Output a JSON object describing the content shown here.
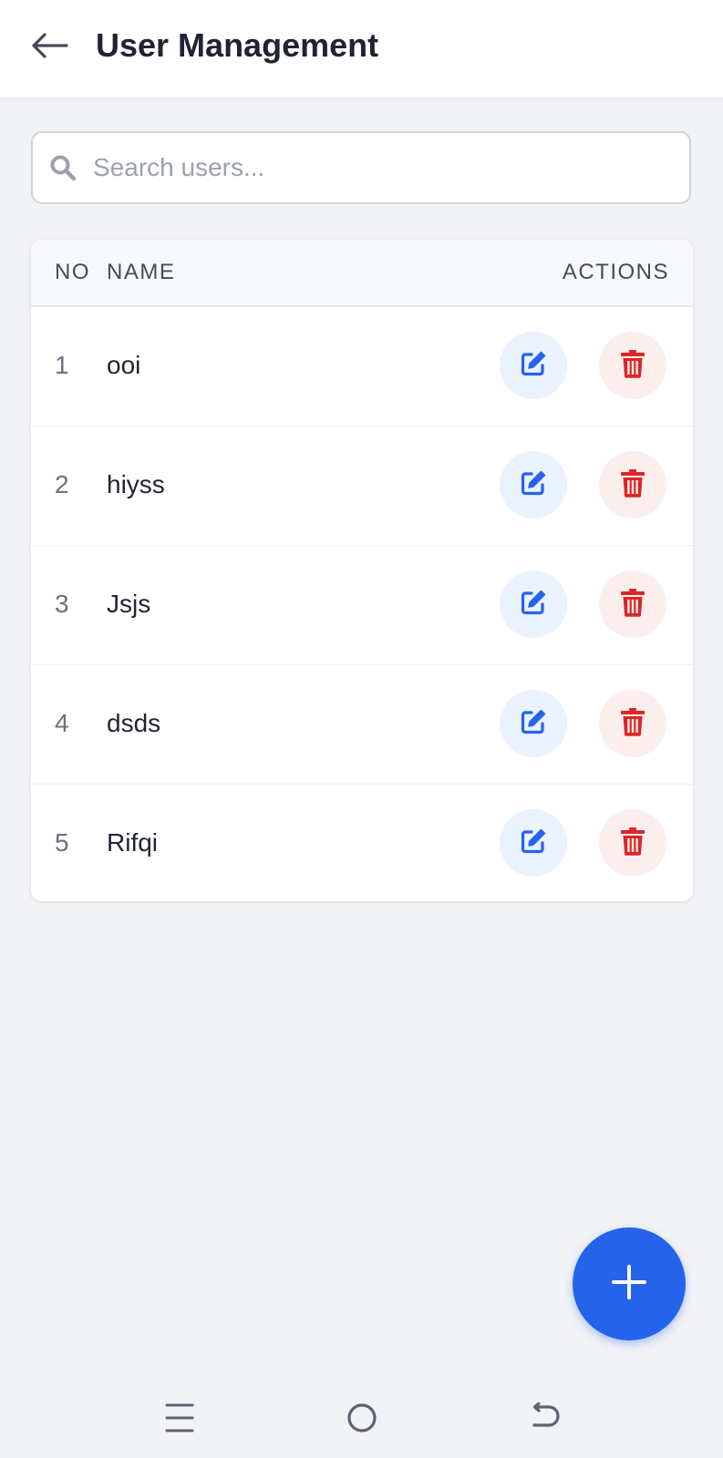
{
  "header": {
    "title": "User Management",
    "back_icon": "arrow-left-icon"
  },
  "search": {
    "placeholder": "Search users...",
    "value": "",
    "icon": "search-icon"
  },
  "table": {
    "columns": {
      "no": "NO",
      "name": "NAME",
      "actions": "ACTIONS"
    },
    "rows": [
      {
        "no": "1",
        "name": "ooi"
      },
      {
        "no": "2",
        "name": "hiyss"
      },
      {
        "no": "3",
        "name": "Jsjs"
      },
      {
        "no": "4",
        "name": "dsds"
      },
      {
        "no": "5",
        "name": "Rifqi"
      }
    ],
    "row_actions": {
      "edit_icon": "edit-icon",
      "delete_icon": "trash-icon"
    }
  },
  "fab": {
    "icon": "plus-icon"
  },
  "system_nav": {
    "items": [
      "menu-icon",
      "home-icon",
      "back-icon"
    ]
  },
  "colors": {
    "primary": "#2563eb",
    "danger": "#dc2626",
    "edit_bg": "#eaf2fe",
    "delete_bg": "#fdeeee",
    "background": "#f2f3f6"
  }
}
